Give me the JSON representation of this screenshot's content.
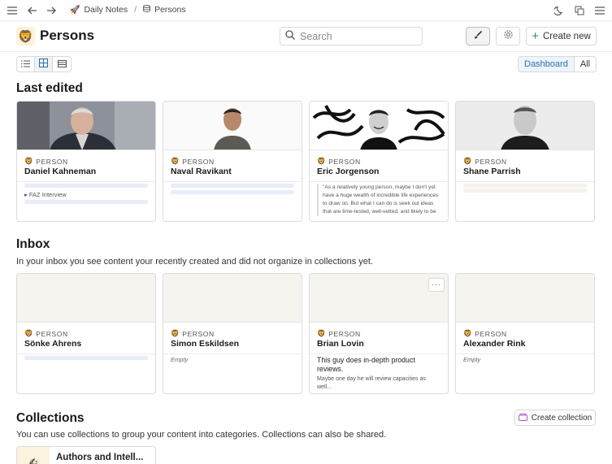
{
  "breadcrumb": [
    {
      "icon": "rocket-icon",
      "label": "Daily Notes"
    },
    {
      "icon": "list-icon",
      "label": "Persons"
    }
  ],
  "header": {
    "title": "Persons",
    "logo": "🦁",
    "search_placeholder": "Search",
    "create_new_label": "Create new"
  },
  "views": [
    "list-view-icon",
    "grid-view-icon",
    "table-view-icon"
  ],
  "scope": {
    "dashboard": "Dashboard",
    "all": "All"
  },
  "last_edited": {
    "title": "Last edited",
    "cards": [
      {
        "type": "PERSON",
        "name": "Daniel Kahneman",
        "detail": "FAZ Interview"
      },
      {
        "type": "PERSON",
        "name": "Naval Ravikant"
      },
      {
        "type": "PERSON",
        "name": "Eric Jorgenson",
        "quote": "\"As a relatively young person, maybe I don't yet have a huge wealth of incredible life experiences to draw on. But what I can do is seek out ideas that are time-tested, well-vetted, and likely to be helpful—and then"
      },
      {
        "type": "PERSON",
        "name": "Shane Parrish"
      }
    ]
  },
  "inbox": {
    "title": "Inbox",
    "subtitle": "In your inbox you see content your recently created and did not organize in collections yet.",
    "cards": [
      {
        "type": "PERSON",
        "name": "Sönke Ahrens"
      },
      {
        "type": "PERSON",
        "name": "Simon Eskildsen",
        "empty": "Empty"
      },
      {
        "type": "PERSON",
        "name": "Brian Lovin",
        "desc": "This guy does in-depth product reviews.",
        "desc_sub": "Maybe one day he will review capacities as well..."
      },
      {
        "type": "PERSON",
        "name": "Alexander Rink",
        "empty": "Empty"
      }
    ]
  },
  "collections": {
    "title": "Collections",
    "subtitle": "You can use collections to group your content into categories. Collections can also be shared.",
    "create_label": "Create collection",
    "items": [
      {
        "name": "Authors and Intell...",
        "icon": "✍"
      }
    ]
  },
  "colors": {
    "accent": "#2f6fb5",
    "green": "#2e8b57",
    "bar": "#e7eefa"
  }
}
